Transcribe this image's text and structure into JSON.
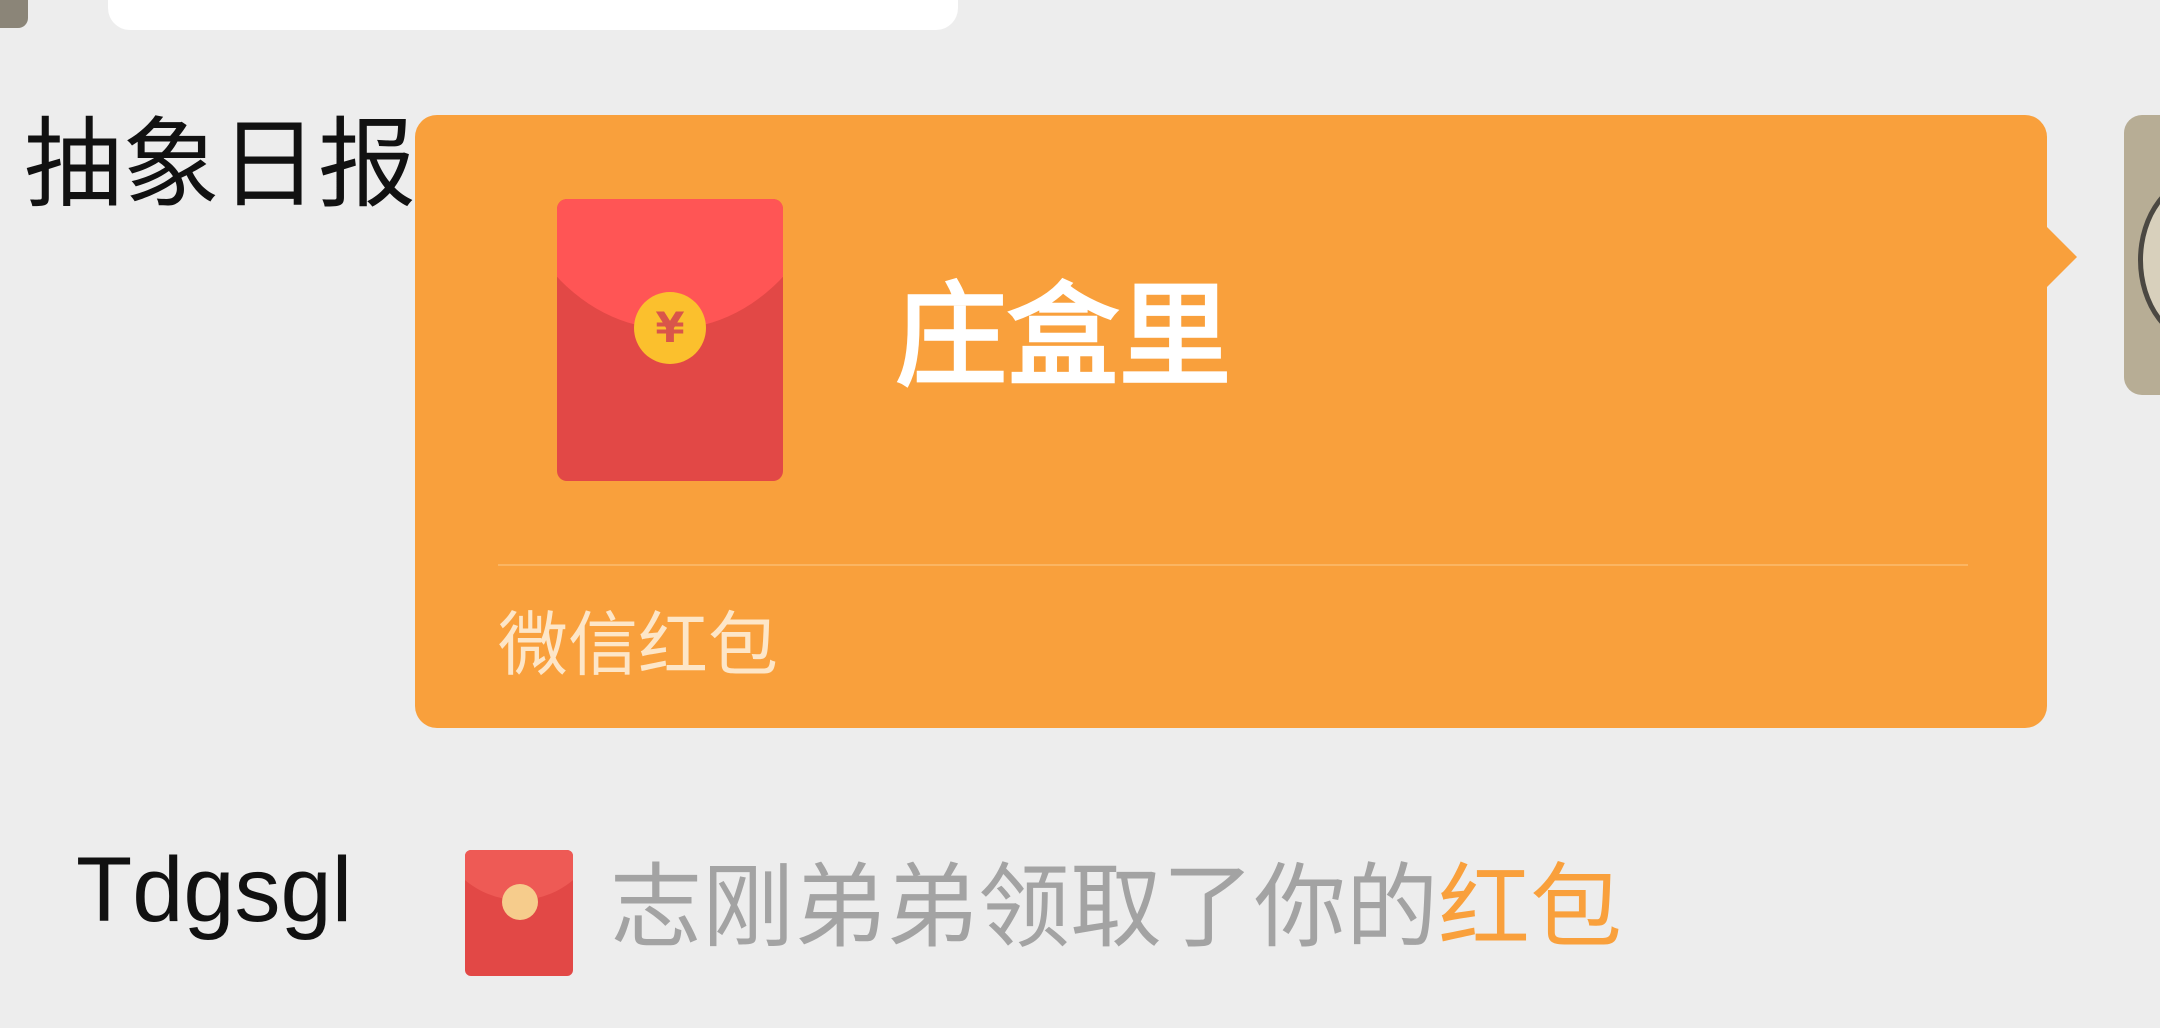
{
  "chat": {
    "sender_label": "抽象日报",
    "packet": {
      "title": "庄盒里",
      "footer": "微信红包",
      "coin_symbol": "¥",
      "bubble_color": "#f9a03c",
      "packet_color": "#e24846"
    },
    "system_message": {
      "user_label": "Tdgsgl",
      "text": "志刚弟弟领取了你的",
      "link_text": "红包",
      "link_color": "#f9a03c",
      "icon": "red-packet-icon"
    }
  }
}
